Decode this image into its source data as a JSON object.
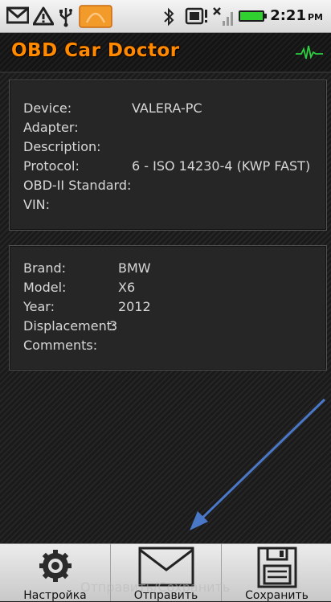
{
  "status_bar": {
    "time": "2:21",
    "ampm": "PM",
    "icons": [
      "mail-icon",
      "warning-icon",
      "usb-icon",
      "app-notification-icon",
      "bluetooth-icon",
      "sd-card-icon",
      "no-signal-icon",
      "battery-icon"
    ]
  },
  "app": {
    "title": "OBD Car Doctor",
    "pulse_icon": "heartbeat-icon"
  },
  "device_panel": {
    "rows": [
      {
        "label": "Device:",
        "value": "VALERA-PC"
      },
      {
        "label": "Adapter:",
        "value": ""
      },
      {
        "label": "Description:",
        "value": ""
      },
      {
        "label": "Protocol:",
        "value": "6 - ISO 14230-4 (KWP FAST)"
      },
      {
        "label": "OBD-II Standard:",
        "value": ""
      },
      {
        "label": "VIN:",
        "value": ""
      }
    ]
  },
  "car_panel": {
    "rows": [
      {
        "label": "Brand:",
        "value": "BMW"
      },
      {
        "label": "Model:",
        "value": "X6"
      },
      {
        "label": "Year:",
        "value": "2012"
      },
      {
        "label": "Displacement:",
        "value": "3"
      },
      {
        "label": "Comments:",
        "value": ""
      }
    ]
  },
  "bottom_bar": {
    "tabs": [
      {
        "label": "Настройка",
        "icon": "settings-gear-icon"
      },
      {
        "label": "Отправить",
        "icon": "envelope-icon"
      },
      {
        "label": "Сохранить",
        "icon": "floppy-disk-icon"
      }
    ],
    "overlay_text": "Отправить/Сохранить"
  },
  "colors": {
    "title": "#ff8a00",
    "pulse": "#2ecc40",
    "arrow": "#4a78c8"
  }
}
